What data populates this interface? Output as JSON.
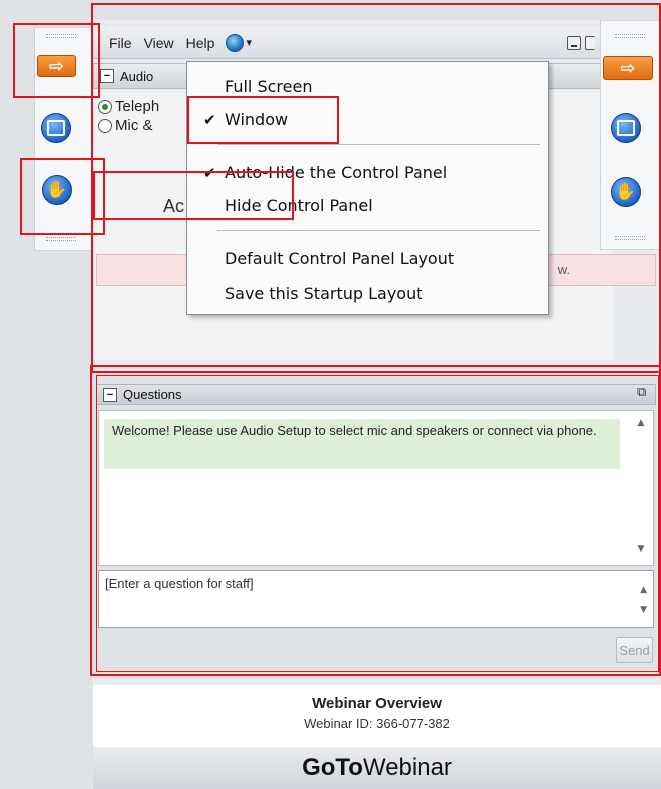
{
  "menubar": {
    "file": "File",
    "view": "View",
    "help": "Help",
    "globe_caret": "▾"
  },
  "audio": {
    "title": "Audio",
    "telephone_label": "Teleph",
    "mic_label": "Mic &",
    "partial_heading": "Ac",
    "partial_notice": "w."
  },
  "view_menu": {
    "full_screen": "Full Screen",
    "window": "Window",
    "auto_hide": "Auto-Hide the Control Panel",
    "hide_panel": "Hide Control Panel",
    "default_layout": "Default Control Panel Layout",
    "save_layout": "Save this Startup Layout",
    "checkmark": "✔"
  },
  "questions": {
    "title": "Questions",
    "welcome": "Welcome! Please use Audio Setup to select mic and speakers or connect via phone.",
    "input_placeholder": "[Enter a question for staff]",
    "send": "Send"
  },
  "overview": {
    "title": "Webinar Overview",
    "id_text": "Webinar ID: 366-077-382"
  },
  "brand": {
    "goto": "GoTo",
    "webinar": "Webinar"
  },
  "icons": {
    "arrow": "⇨",
    "scroll_up": "▲",
    "scroll_down": "▼",
    "popout": "⧉"
  },
  "colors": {
    "accent_orange": "#e06a10",
    "accent_blue": "#1d63c6",
    "highlight_red": "#e0161c",
    "welcome_green": "#dfeed8"
  }
}
